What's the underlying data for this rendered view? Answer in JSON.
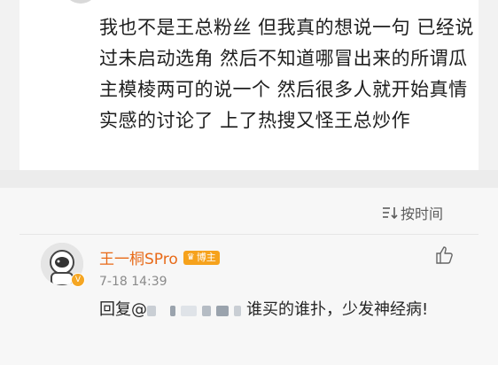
{
  "post": {
    "text": "我也不是王总粉丝 但我真的想说一句 已经说过未启动选角 然后不知道哪冒出来的所谓瓜主模棱两可的说一个 然后很多人就开始真情实感的讨论了 上了热搜又怪王总炒作"
  },
  "comments": {
    "sort_label": "按时间",
    "items": [
      {
        "username": "王一桐SPro",
        "badge_label": "博主",
        "verified_icon": "v-badge",
        "time": "7-18 14:39",
        "reply_prefix": "回复@",
        "reply_text": "谁买的谁扑，少发神经病!"
      }
    ]
  },
  "colors": {
    "username": "#e86a18",
    "badge": "#f6a21c",
    "text": "#1e1e1e",
    "muted": "#8a8a8a"
  }
}
